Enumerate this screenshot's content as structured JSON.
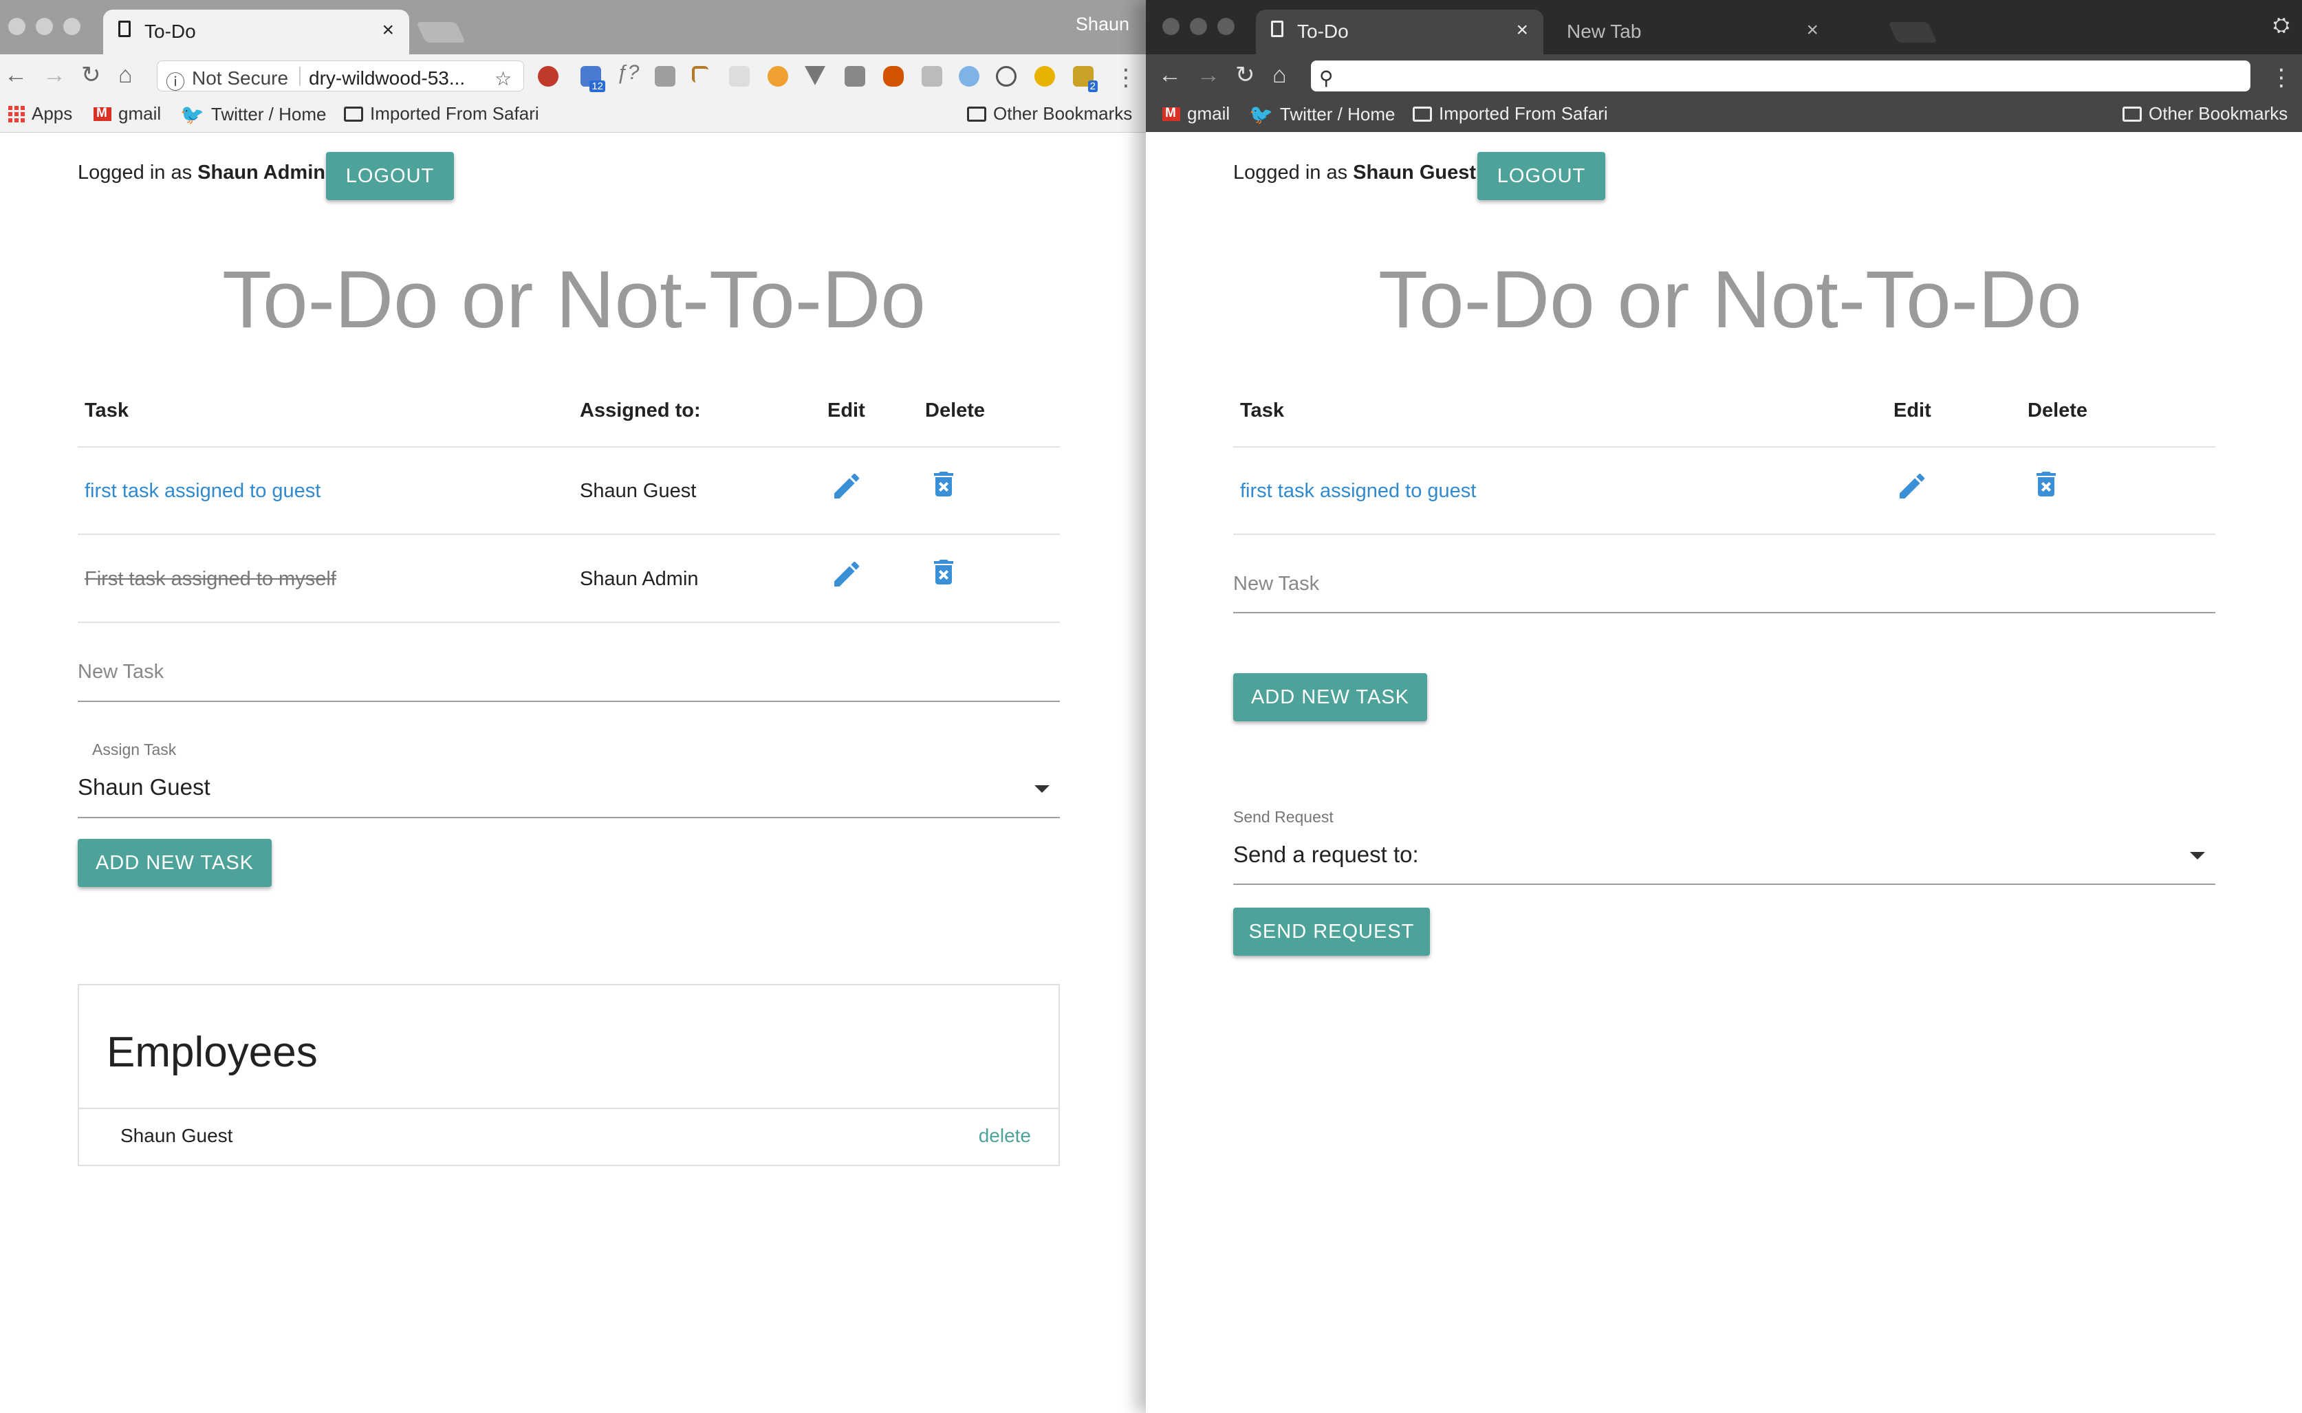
{
  "left_window": {
    "tabs": [
      {
        "title": "To-Do",
        "close": "×"
      }
    ],
    "profile_name": "Shaun",
    "address_bar": {
      "security_label": "Not Secure",
      "url": "dry-wildwood-53..."
    },
    "bookmarks": [
      "Apps",
      "gmail",
      "Twitter / Home",
      "Imported From Safari"
    ],
    "other_bookmarks": "Other Bookmarks",
    "extension_badges": {
      "calendar": "12",
      "shopping": "2"
    },
    "page": {
      "logged_in_prefix": "Logged in as",
      "user_name": "Shaun Admin",
      "logout_label": "LOGOUT",
      "app_title": "To-Do or Not-To-Do",
      "table_headers": {
        "task": "Task",
        "assigned_to": "Assigned to:",
        "edit": "Edit",
        "delete": "Delete"
      },
      "tasks": [
        {
          "text": "first task assigned to guest",
          "assigned_to": "Shaun Guest",
          "completed": false
        },
        {
          "text": "First task assigned to myself",
          "assigned_to": "Shaun Admin",
          "completed": true
        }
      ],
      "new_task_placeholder": "New Task",
      "assign_task_label": "Assign Task",
      "assign_task_value": "Shaun Guest",
      "add_task_label": "ADD NEW TASK",
      "employees": {
        "title": "Employees",
        "items": [
          {
            "name": "Shaun Guest",
            "action": "delete"
          }
        ]
      }
    }
  },
  "right_window": {
    "tabs": [
      {
        "title": "To-Do",
        "close": "×"
      },
      {
        "title": "New Tab",
        "close": "×"
      }
    ],
    "address_bar": {
      "url": ""
    },
    "bookmarks": [
      "gmail",
      "Twitter / Home",
      "Imported From Safari"
    ],
    "other_bookmarks": "Other Bookmarks",
    "page": {
      "logged_in_prefix": "Logged in as",
      "user_name": "Shaun Guest",
      "logout_label": "LOGOUT",
      "app_title": "To-Do or Not-To-Do",
      "table_headers": {
        "task": "Task",
        "edit": "Edit",
        "delete": "Delete"
      },
      "tasks": [
        {
          "text": "first task assigned to guest",
          "completed": false
        }
      ],
      "new_task_placeholder": "New Task",
      "add_task_label": "ADD NEW TASK",
      "send_request_label": "Send Request",
      "send_request_value": "Send a request to:",
      "send_request_button": "SEND REQUEST"
    }
  },
  "colors": {
    "accent": "#4da39a",
    "link": "#2f8ad0",
    "title_gray": "#9a9a9a"
  },
  "icons": [
    "document-icon",
    "close-icon",
    "back-icon",
    "forward-icon",
    "reload-icon",
    "home-icon",
    "info-icon",
    "star-icon",
    "search-icon",
    "menu-icon",
    "pencil-icon",
    "trash-icon",
    "dropdown-caret-icon",
    "folder-icon",
    "twitter-icon",
    "gmail-icon",
    "apps-icon",
    "incognito-icon"
  ]
}
